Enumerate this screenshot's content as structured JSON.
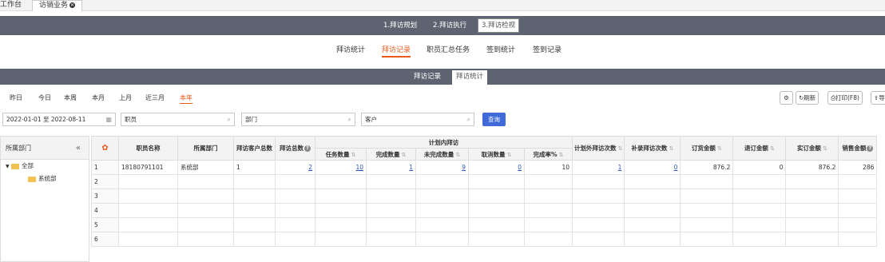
{
  "top_tabs": {
    "workbench": "工作台",
    "visit_business": "访销业务"
  },
  "steps": [
    "1.拜访规划",
    "2.拜访执行",
    "3.拜访检视"
  ],
  "subnav": [
    "拜访统计",
    "拜访记录",
    "职员汇总任务",
    "签到统计",
    "签到记录"
  ],
  "subtabs": [
    "拜访记录",
    "拜访统计"
  ],
  "date_filters": [
    "昨日",
    "今日",
    "本周",
    "本月",
    "上月",
    "近三月",
    "本年"
  ],
  "toolbar": {
    "refresh_label": "刷新",
    "print_label": "打印(F8)",
    "export_label": "导"
  },
  "filters": {
    "date_range": "2022-01-01 至 2022-08-11",
    "employee_placeholder": "职员",
    "department_placeholder": "部门",
    "customer_placeholder": "客户",
    "query_label": "查询"
  },
  "left_panel": {
    "title": "所属部门",
    "tree": {
      "root": "全部",
      "child": "系统部"
    }
  },
  "table": {
    "group_header": "计划内拜访",
    "columns": {
      "employee_name": "职员名称",
      "department": "所属部门",
      "customer_total": "拜访客户总数",
      "visit_total": "拜访总数",
      "task_count": "任务数量",
      "done_count": "完成数量",
      "undone_count": "未完成数量",
      "cancel_count": "取消数量",
      "completion_rate": "完成率%",
      "unplanned_visits": "计划外拜访次数",
      "supplement_visits": "补录拜访次数",
      "order_amount": "订货金额",
      "return_amount": "退订金额",
      "actual_amount": "实订金额",
      "sales_amount": "销售金额"
    },
    "row_numbers": [
      "1",
      "2",
      "3",
      "4",
      "5",
      "6"
    ],
    "row1": {
      "employee_name": "18180791101",
      "department": "系统部",
      "customer_total": "1",
      "visit_total": "2",
      "task_count": "10",
      "done_count": "1",
      "undone_count": "9",
      "cancel_count": "0",
      "completion_rate": "10",
      "unplanned_visits": "1",
      "supplement_visits": "0",
      "order_amount": "876.2",
      "return_amount": "0",
      "actual_amount": "876.2",
      "sales_amount": "286"
    }
  },
  "colors": {
    "accent": "#e85a1b",
    "bar": "#5d6370",
    "query": "#3f6ad8",
    "link": "#2b55b8"
  }
}
